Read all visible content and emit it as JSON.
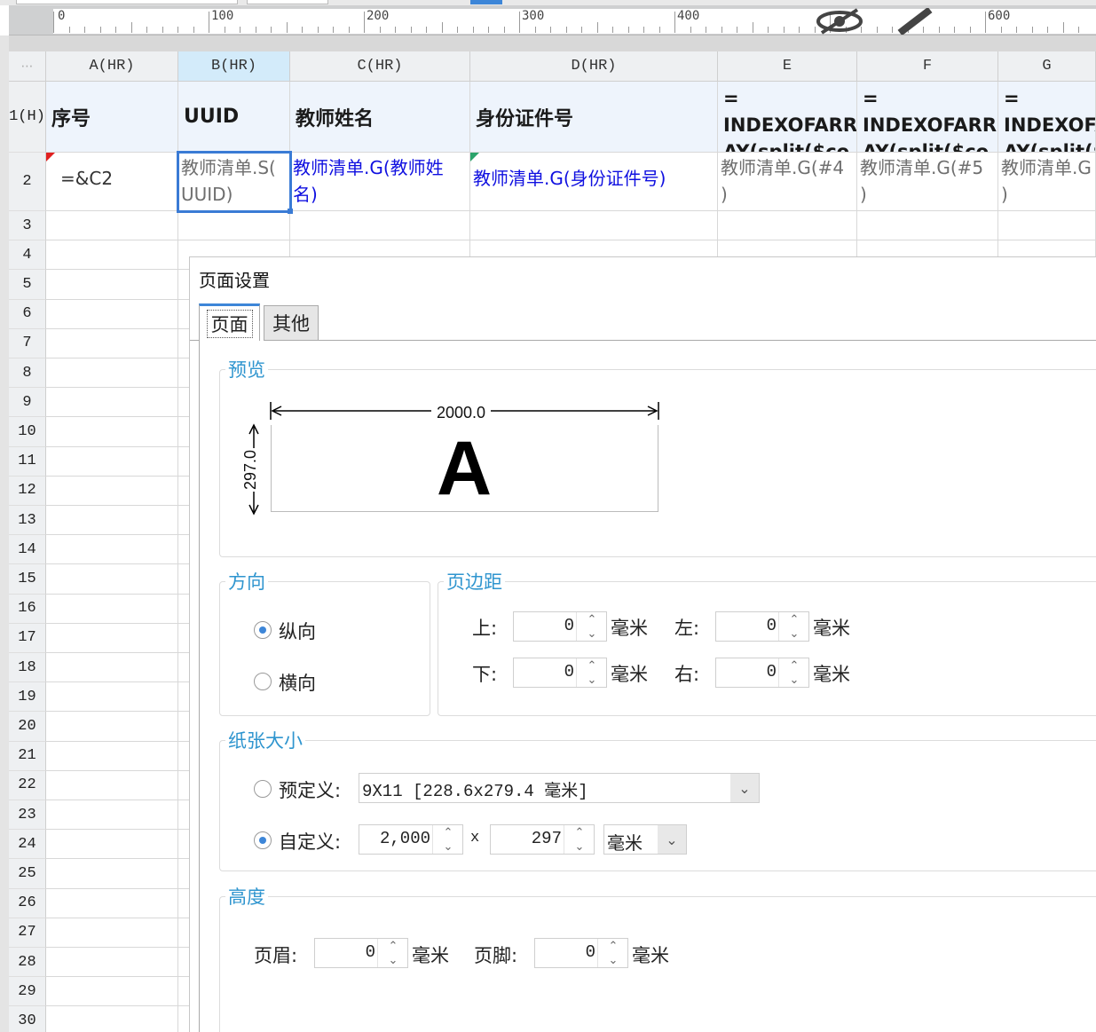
{
  "ruler": {
    "labels": [
      "0",
      "100",
      "200",
      "300",
      "400",
      "600"
    ]
  },
  "sheet": {
    "columns": [
      "A(HR)",
      "B(HR)",
      "C(HR)",
      "D(HR)",
      "E",
      "F",
      "G"
    ],
    "row_numbers": [
      "1(H)",
      "2",
      "3",
      "4",
      "5",
      "6",
      "7",
      "8",
      "9",
      "10",
      "11",
      "12",
      "13",
      "14",
      "15",
      "16",
      "17",
      "18",
      "19",
      "20",
      "21",
      "22",
      "23",
      "24",
      "25",
      "26",
      "27",
      "28",
      "29",
      "30"
    ],
    "row1": {
      "a": "序号",
      "b": "UUID",
      "c": "教师姓名",
      "d": "身份证件号",
      "e": "=\nINDEXOFARR\nAY(split($co",
      "f": "=\nINDEXOFARR\nAY(split($co",
      "g": "=\nINDEXOFARR\nAY(split($"
    },
    "row2": {
      "a": "=&C2",
      "b": "教师清单.S(\nUUID)",
      "c": "教师清单.G(教师姓\n名)",
      "d": "教师清单.G(身份证件号)",
      "e": "教师清单.G(#4\n)",
      "f": "教师清单.G(#5\n)",
      "g": "教师清单.G\n)"
    },
    "colors": {
      "selection": "#3a7bd5",
      "formula_text": "#1010e0",
      "header_fill": "#eef4fc"
    }
  },
  "dialog": {
    "title": "页面设置",
    "tabs": [
      "页面",
      "其他"
    ],
    "preview": {
      "label": "预览",
      "width_value": "2000.0",
      "height_value": "297.0",
      "letter": "A"
    },
    "orientation": {
      "label": "方向",
      "portrait": "纵向",
      "landscape": "横向",
      "selected": "纵向"
    },
    "margins": {
      "label": "页边距",
      "top_label": "上:",
      "bottom_label": "下:",
      "left_label": "左:",
      "right_label": "右:",
      "top": "0",
      "bottom": "0",
      "left": "0",
      "right": "0",
      "unit": "毫米"
    },
    "paper": {
      "label": "纸张大小",
      "predefined_label": "预定义:",
      "predefined_value": "9X11 [228.6x279.4 毫米]",
      "custom_label": "自定义:",
      "custom_width": "2,000",
      "times": "x",
      "custom_height": "297",
      "unit": "毫米",
      "selected": "自定义"
    },
    "height": {
      "label": "高度",
      "header_label": "页眉:",
      "header_value": "0",
      "footer_label": "页脚:",
      "footer_value": "0",
      "unit": "毫米"
    },
    "colors": {
      "group_label": "#2f95cf",
      "radio_selected": "#3d86d8"
    }
  }
}
